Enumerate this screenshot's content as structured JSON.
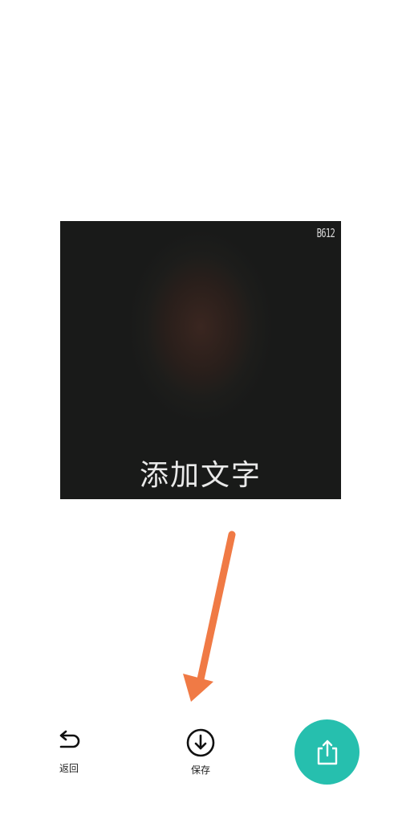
{
  "preview": {
    "watermark": "B612",
    "caption": "添加文字"
  },
  "toolbar": {
    "back_label": "返回",
    "save_label": "保存"
  },
  "colors": {
    "accent": "#26bfae",
    "annotation_arrow": "#f07a45"
  }
}
